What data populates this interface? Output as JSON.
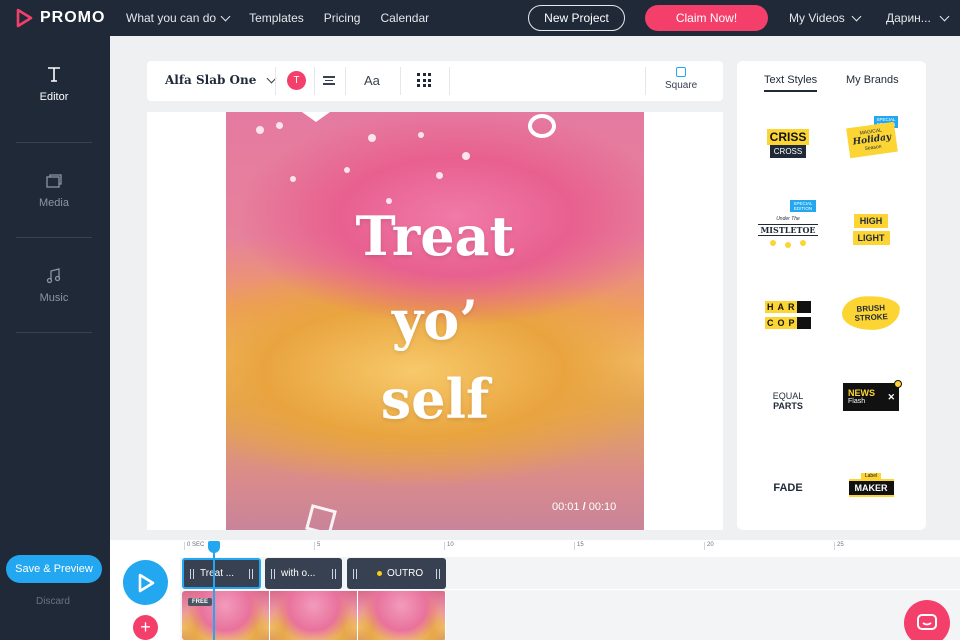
{
  "brand": {
    "name": "PROMO",
    "accent": "#f43f6b",
    "blue": "#22a7f0"
  },
  "nav": {
    "items": [
      {
        "label": "What you can do",
        "has_dropdown": true
      },
      {
        "label": "Templates"
      },
      {
        "label": "Pricing"
      },
      {
        "label": "Calendar"
      }
    ],
    "new_project": "New Project",
    "claim_now": "Claim Now!",
    "my_videos": "My Videos",
    "user": "Дарин..."
  },
  "sidebar": {
    "items": [
      {
        "label": "Editor",
        "icon": "text-t-icon",
        "active": true
      },
      {
        "label": "Media",
        "icon": "media-stack-icon"
      },
      {
        "label": "Music",
        "icon": "music-note-icon"
      }
    ],
    "save_preview": "Save & Preview",
    "discard": "Discard"
  },
  "toolbar": {
    "font": "Alfa Slab One",
    "color_label": "T",
    "size_label": "Aa",
    "square_label": "Square"
  },
  "preview": {
    "lines": [
      "Treat",
      "yo’",
      "self"
    ],
    "time_current": "00:01",
    "time_sep": "/",
    "time_total": "00:10"
  },
  "right_panel": {
    "tabs": [
      {
        "label": "Text Styles",
        "active": true
      },
      {
        "label": "My Brands"
      }
    ],
    "styles": [
      {
        "name": "criss-cross",
        "l1": "CRISS",
        "l2": "CROSS"
      },
      {
        "name": "magical-holiday",
        "l0": "SPECIAL EDITION",
        "l1": "MAGICAL",
        "l2": "Holiday",
        "l3": "Season"
      },
      {
        "name": "under-the-mistletoe",
        "l0": "SPECIAL EDITION",
        "l1": "Under The",
        "l2": "MISTLETOE"
      },
      {
        "name": "high-light",
        "l1": "HIGH",
        "l2": "LIGHT"
      },
      {
        "name": "hard-copy",
        "l1": "HARD",
        "l2": "COPY"
      },
      {
        "name": "brush-stroke",
        "l1": "BRUSH",
        "l2": "STROKE"
      },
      {
        "name": "equal-parts",
        "l1": "EQUAL",
        "l2": "PARTS"
      },
      {
        "name": "news-flash",
        "l1": "NEWS",
        "l2": "Flash"
      },
      {
        "name": "fade",
        "l1": "FADE"
      },
      {
        "name": "label-maker",
        "l0": "Label",
        "l1": "MAKER"
      }
    ]
  },
  "timeline": {
    "ruler": [
      "0 SEC",
      "5",
      "10",
      "15",
      "20",
      "25"
    ],
    "clips": [
      {
        "label": "Treat ...",
        "selected": true
      },
      {
        "label": "with o..."
      },
      {
        "label": "OUTRO",
        "dot": true
      }
    ],
    "free_badge": "FREE",
    "add": "+"
  }
}
